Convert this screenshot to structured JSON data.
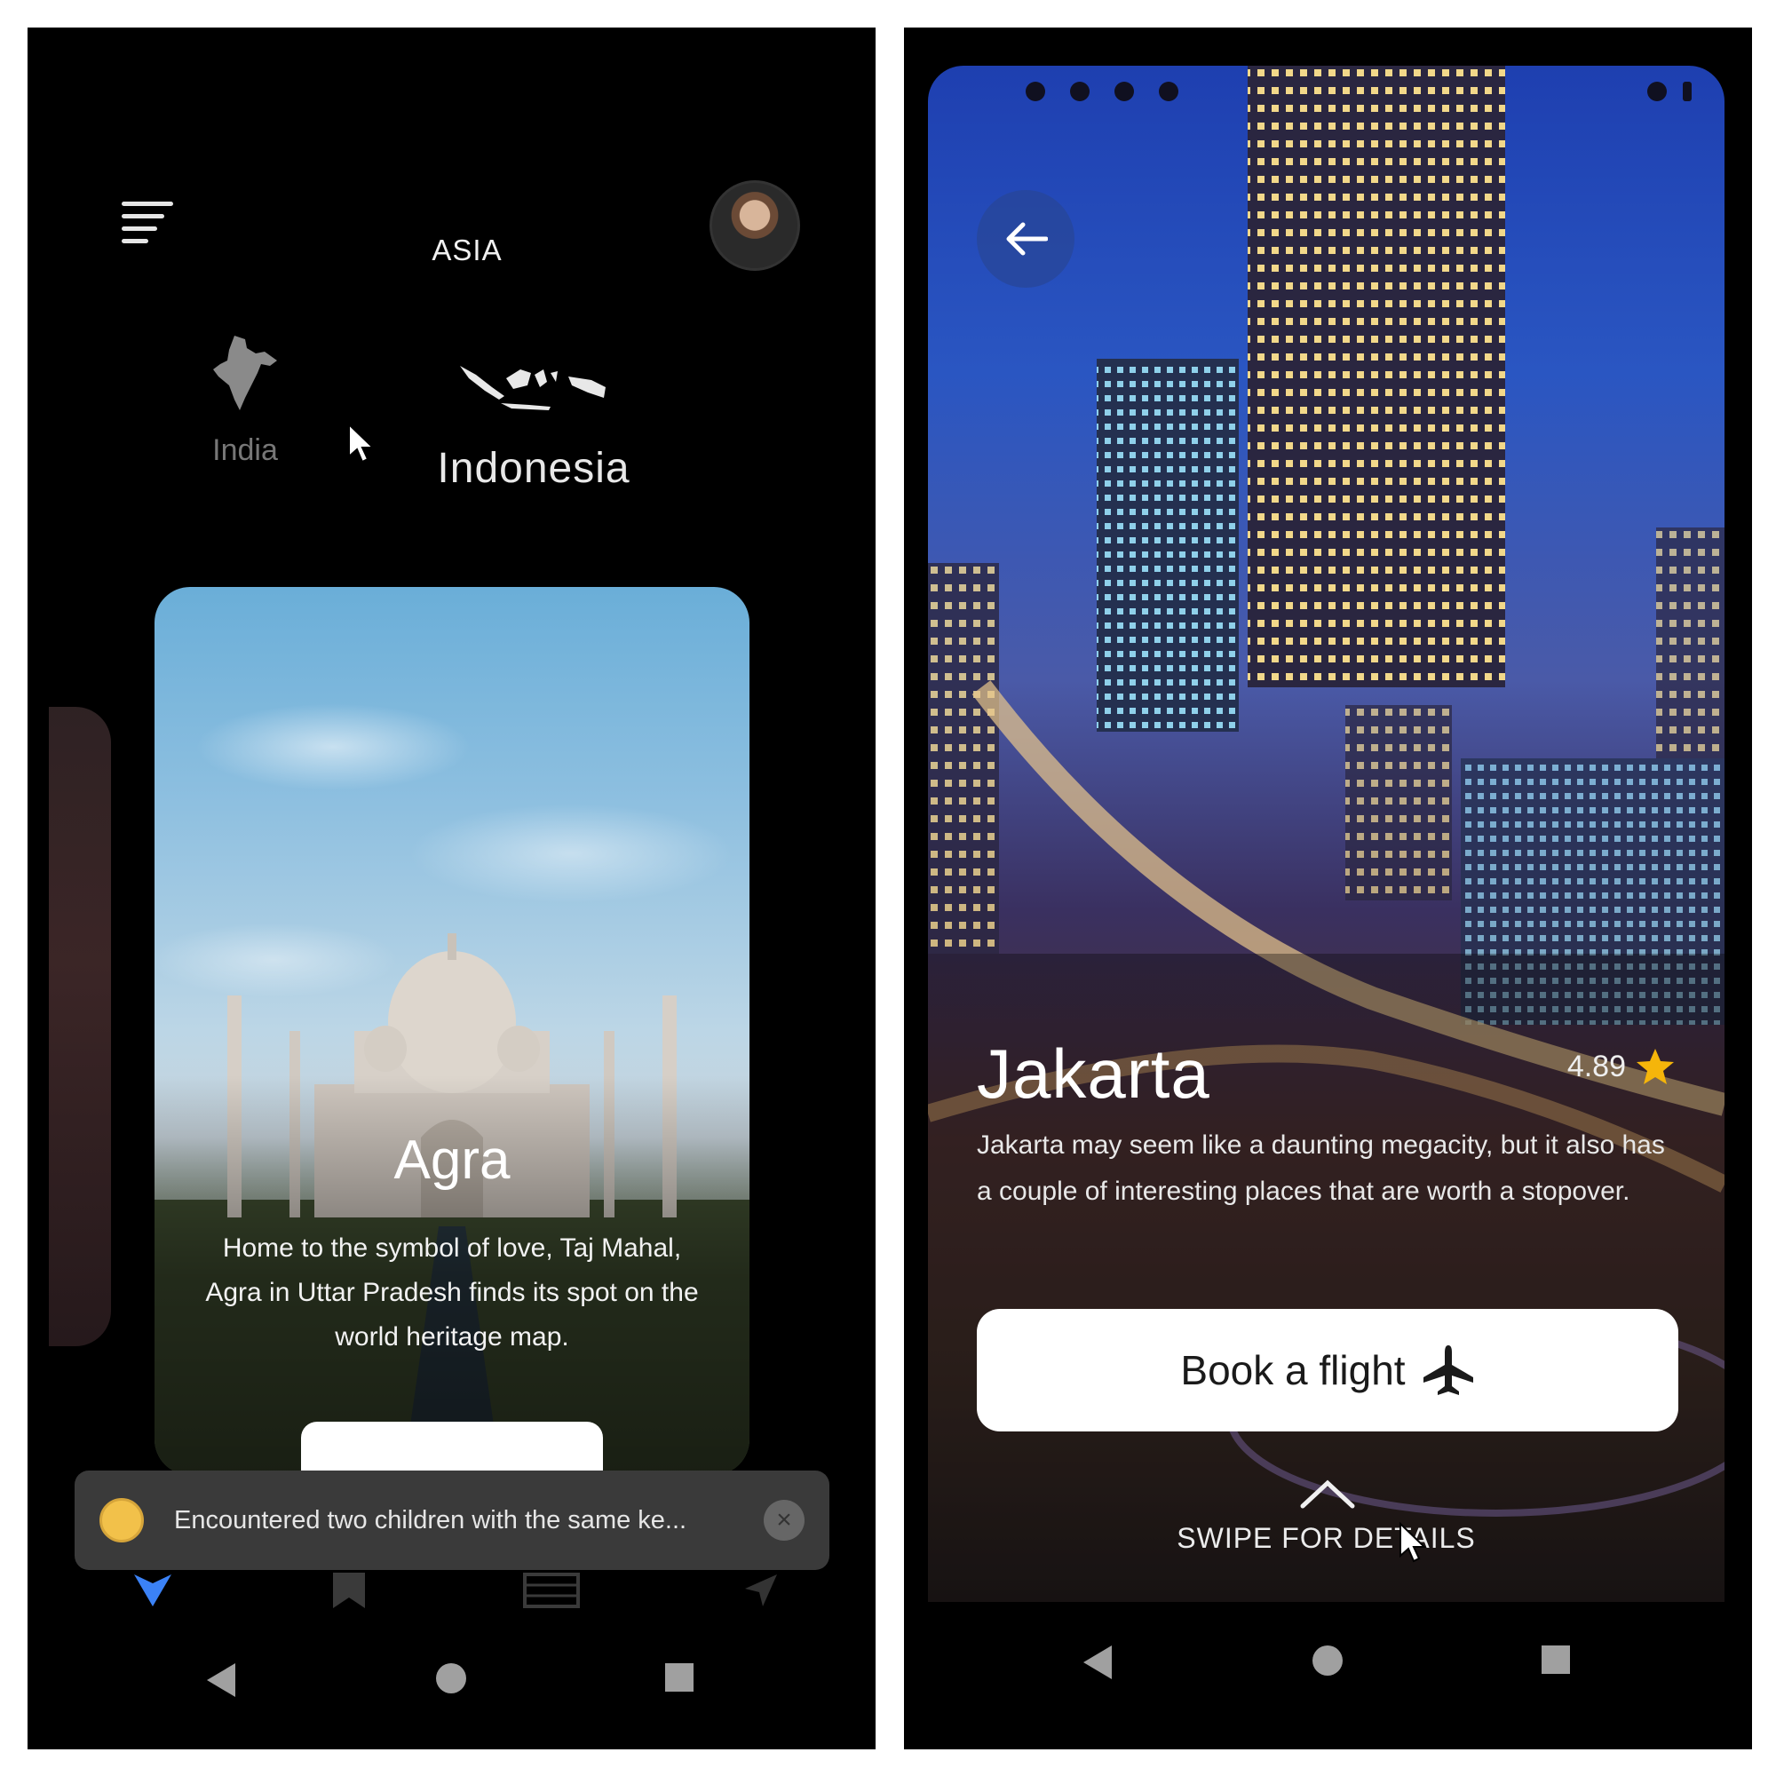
{
  "left_screen": {
    "header": {
      "region_title": "ASIA"
    },
    "countries": [
      {
        "name": "India"
      },
      {
        "name": "Indonesia"
      }
    ],
    "destination_card": {
      "title": "Agra",
      "description": "Home to the symbol of love, Taj Mahal, Agra in Uttar Pradesh finds its spot on the world heritage map."
    },
    "toast": {
      "message": "Encountered two children with the same ke..."
    },
    "bottom_tabs": [
      {
        "icon": "explore-icon",
        "active": true
      },
      {
        "icon": "bookmark-icon",
        "active": false
      },
      {
        "icon": "calendar-icon",
        "active": false
      },
      {
        "icon": "location-icon",
        "active": false
      }
    ],
    "colors": {
      "background": "#000000",
      "active_tab": "#3b82f6",
      "toast_bg": "#3a3a3a"
    }
  },
  "right_screen": {
    "city": {
      "name": "Jakarta",
      "rating": "4.89",
      "description": "Jakarta may seem like a daunting megacity, but it also has a couple of interesting places that are worth a stopover."
    },
    "book_button": {
      "label": "Book a flight",
      "icon": "airplane-icon"
    },
    "swipe_hint": "SWIPE FOR DETAILS",
    "colors": {
      "star": "#f5b50a",
      "button_bg": "#ffffff"
    }
  }
}
